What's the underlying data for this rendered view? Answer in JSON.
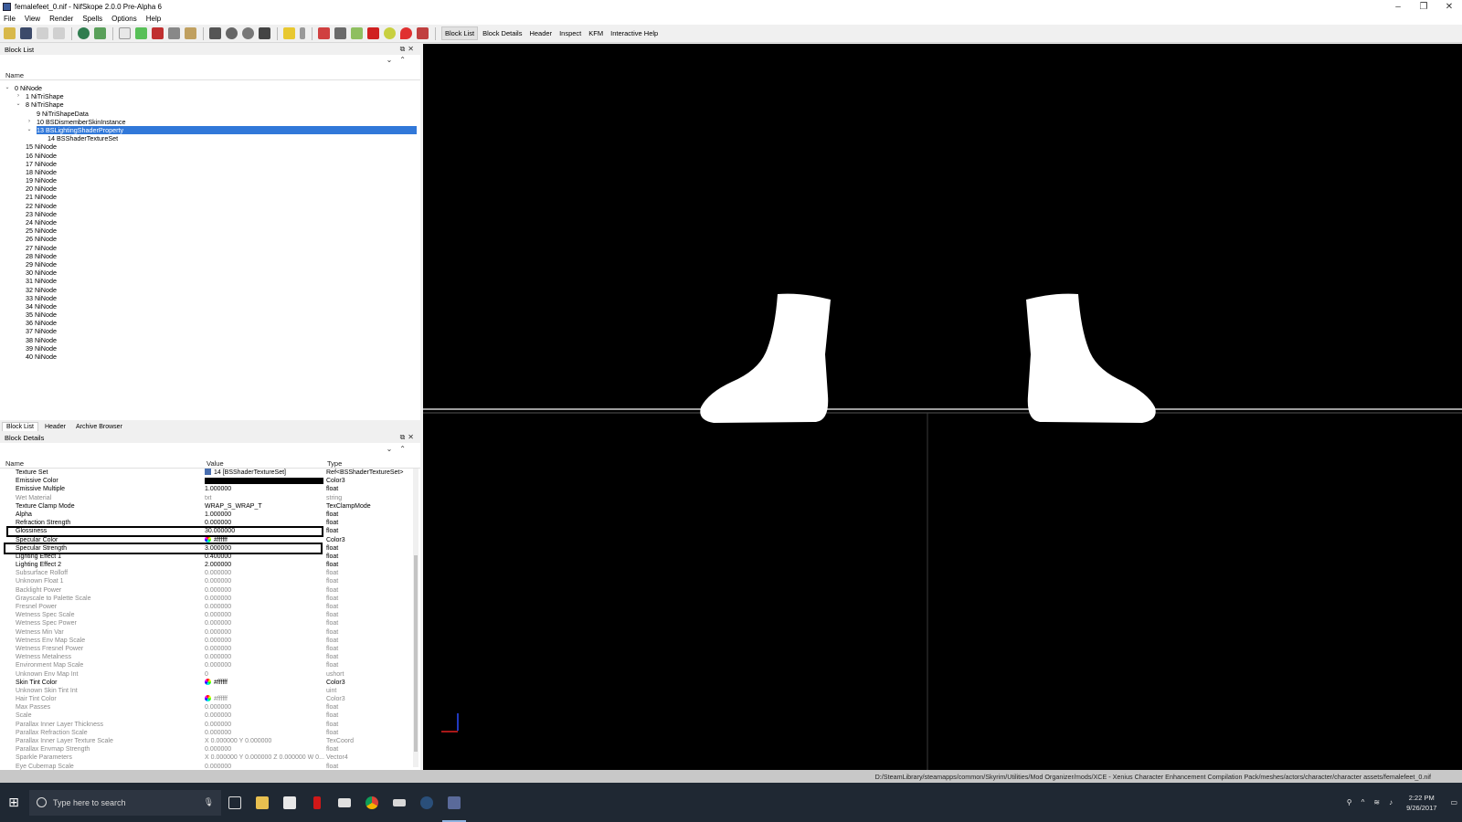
{
  "window": {
    "title": "femalefeet_0.nif - NifSkope 2.0.0 Pre-Alpha 6",
    "minimize": "–",
    "restore": "❐",
    "close": "✕"
  },
  "menu": [
    "File",
    "View",
    "Render",
    "Spells",
    "Options",
    "Help"
  ],
  "toolbar": {
    "tabs": [
      "Block List",
      "Block Details",
      "Header",
      "Inspect",
      "KFM",
      "Interactive Help"
    ]
  },
  "block_list": {
    "title": "Block List",
    "column": "Name",
    "rows": [
      {
        "label": "0 NiNode",
        "depth": 0,
        "arrow": "down"
      },
      {
        "label": "1 NiTriShape",
        "depth": 1,
        "arrow": "right"
      },
      {
        "label": "8 NiTriShape",
        "depth": 1,
        "arrow": "down"
      },
      {
        "label": "9 NiTriShapeData",
        "depth": 2,
        "arrow": ""
      },
      {
        "label": "10 BSDismemberSkinInstance",
        "depth": 2,
        "arrow": "right"
      },
      {
        "label": "13 BSLightingShaderProperty",
        "depth": 2,
        "arrow": "down",
        "selected": true
      },
      {
        "label": "14 BSShaderTextureSet",
        "depth": 3,
        "arrow": ""
      },
      {
        "label": "15 NiNode",
        "depth": 1,
        "arrow": ""
      },
      {
        "label": "16 NiNode",
        "depth": 1,
        "arrow": ""
      },
      {
        "label": "17 NiNode",
        "depth": 1,
        "arrow": ""
      },
      {
        "label": "18 NiNode",
        "depth": 1,
        "arrow": ""
      },
      {
        "label": "19 NiNode",
        "depth": 1,
        "arrow": ""
      },
      {
        "label": "20 NiNode",
        "depth": 1,
        "arrow": ""
      },
      {
        "label": "21 NiNode",
        "depth": 1,
        "arrow": ""
      },
      {
        "label": "22 NiNode",
        "depth": 1,
        "arrow": ""
      },
      {
        "label": "23 NiNode",
        "depth": 1,
        "arrow": ""
      },
      {
        "label": "24 NiNode",
        "depth": 1,
        "arrow": ""
      },
      {
        "label": "25 NiNode",
        "depth": 1,
        "arrow": ""
      },
      {
        "label": "26 NiNode",
        "depth": 1,
        "arrow": ""
      },
      {
        "label": "27 NiNode",
        "depth": 1,
        "arrow": ""
      },
      {
        "label": "28 NiNode",
        "depth": 1,
        "arrow": ""
      },
      {
        "label": "29 NiNode",
        "depth": 1,
        "arrow": ""
      },
      {
        "label": "30 NiNode",
        "depth": 1,
        "arrow": ""
      },
      {
        "label": "31 NiNode",
        "depth": 1,
        "arrow": ""
      },
      {
        "label": "32 NiNode",
        "depth": 1,
        "arrow": ""
      },
      {
        "label": "33 NiNode",
        "depth": 1,
        "arrow": ""
      },
      {
        "label": "34 NiNode",
        "depth": 1,
        "arrow": ""
      },
      {
        "label": "35 NiNode",
        "depth": 1,
        "arrow": ""
      },
      {
        "label": "36 NiNode",
        "depth": 1,
        "arrow": ""
      },
      {
        "label": "37 NiNode",
        "depth": 1,
        "arrow": ""
      },
      {
        "label": "38 NiNode",
        "depth": 1,
        "arrow": ""
      },
      {
        "label": "39 NiNode",
        "depth": 1,
        "arrow": ""
      },
      {
        "label": "40 NiNode",
        "depth": 1,
        "arrow": ""
      }
    ]
  },
  "bottom_tabs": [
    "Block List",
    "Header",
    "Archive Browser"
  ],
  "block_details": {
    "title": "Block Details",
    "columns": [
      "Name",
      "Value",
      "Type"
    ],
    "rows": [
      {
        "name": "Texture Set",
        "value": "14 [BSShaderTextureSet]",
        "type": "Ref<BSShaderTextureSet>",
        "kind": "ref"
      },
      {
        "name": "Emissive Color",
        "value": "",
        "type": "Color3",
        "kind": "colorbar"
      },
      {
        "name": "Emissive Multiple",
        "value": "1.000000",
        "type": "float"
      },
      {
        "name": "Wet Material",
        "value": "txt",
        "type": "string",
        "dim": true
      },
      {
        "name": "Texture Clamp Mode",
        "value": "WRAP_S_WRAP_T",
        "type": "TexClampMode"
      },
      {
        "name": "Alpha",
        "value": "1.000000",
        "type": "float"
      },
      {
        "name": "Refraction Strength",
        "value": "0.000000",
        "type": "float"
      },
      {
        "name": "Glossiness",
        "value": "30.000000",
        "type": "float",
        "highlight": true
      },
      {
        "name": "Specular Color",
        "value": "#ffffff",
        "type": "Color3",
        "kind": "swatch"
      },
      {
        "name": "Specular Strength",
        "value": "3.000000",
        "type": "float",
        "highlight": true
      },
      {
        "name": "Lighting Effect 1",
        "value": "0.400000",
        "type": "float"
      },
      {
        "name": "Lighting Effect 2",
        "value": "2.000000",
        "type": "float"
      },
      {
        "name": "Subsurface Rolloff",
        "value": "0.000000",
        "type": "float",
        "dim": true
      },
      {
        "name": "Unknown Float 1",
        "value": "0.000000",
        "type": "float",
        "dim": true
      },
      {
        "name": "Backlight Power",
        "value": "0.000000",
        "type": "float",
        "dim": true
      },
      {
        "name": "Grayscale to Palette Scale",
        "value": "0.000000",
        "type": "float",
        "dim": true
      },
      {
        "name": "Fresnel Power",
        "value": "0.000000",
        "type": "float",
        "dim": true
      },
      {
        "name": "Wetness Spec Scale",
        "value": "0.000000",
        "type": "float",
        "dim": true
      },
      {
        "name": "Wetness Spec Power",
        "value": "0.000000",
        "type": "float",
        "dim": true
      },
      {
        "name": "Wetness Min Var",
        "value": "0.000000",
        "type": "float",
        "dim": true
      },
      {
        "name": "Wetness Env Map Scale",
        "value": "0.000000",
        "type": "float",
        "dim": true
      },
      {
        "name": "Wetness Fresnel Power",
        "value": "0.000000",
        "type": "float",
        "dim": true
      },
      {
        "name": "Wetness Metalness",
        "value": "0.000000",
        "type": "float",
        "dim": true
      },
      {
        "name": "Environment Map Scale",
        "value": "0.000000",
        "type": "float",
        "dim": true
      },
      {
        "name": "Unknown Env Map Int",
        "value": "0",
        "type": "ushort",
        "dim": true
      },
      {
        "name": "Skin Tint Color",
        "value": "#ffffff",
        "type": "Color3",
        "kind": "swatch"
      },
      {
        "name": "Unknown Skin Tint Int",
        "value": "",
        "type": "uint",
        "dim": true
      },
      {
        "name": "Hair Tint Color",
        "value": "#ffffff",
        "type": "Color3",
        "kind": "swatch",
        "dim": true
      },
      {
        "name": "Max Passes",
        "value": "0.000000",
        "type": "float",
        "dim": true
      },
      {
        "name": "Scale",
        "value": "0.000000",
        "type": "float",
        "dim": true
      },
      {
        "name": "Parallax Inner Layer Thickness",
        "value": "0.000000",
        "type": "float",
        "dim": true
      },
      {
        "name": "Parallax Refraction Scale",
        "value": "0.000000",
        "type": "float",
        "dim": true
      },
      {
        "name": "Parallax Inner Layer Texture Scale",
        "value": "X 0.000000 Y 0.000000",
        "type": "TexCoord",
        "dim": true
      },
      {
        "name": "Parallax Envmap Strength",
        "value": "0.000000",
        "type": "float",
        "dim": true
      },
      {
        "name": "Sparkle Parameters",
        "value": "X 0.000000 Y 0.000000 Z 0.000000 W 0...",
        "type": "Vector4",
        "dim": true
      },
      {
        "name": "Eye Cubemap Scale",
        "value": "0.000000",
        "type": "float",
        "dim": true
      }
    ]
  },
  "status": {
    "path": "D:/SteamLibrary/steamapps/common/Skyrim/Utilities/Mod Organizer/mods/XCE - Xenius Character Enhancement Compilation Pack/meshes/actors/character/character assets/femalefeet_0.nif"
  },
  "taskbar": {
    "search_placeholder": "Type here to search",
    "time": "2:22 PM",
    "date": "9/26/2017"
  },
  "colors": {
    "selection": "#3178d9",
    "viewport_bg": "#000000",
    "taskbar_bg": "#1f2833"
  }
}
